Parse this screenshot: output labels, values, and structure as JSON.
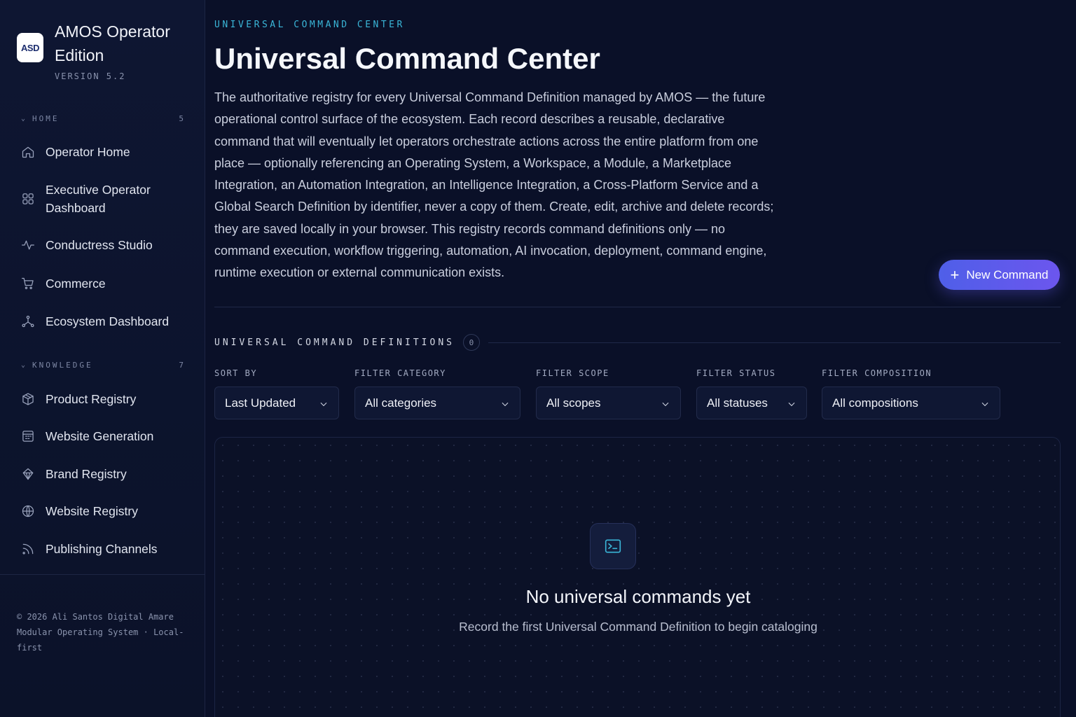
{
  "sidebar": {
    "logo_text": "ASD",
    "brand_title": "AMOS Operator Edition",
    "version": "VERSION 5.2",
    "sections": [
      {
        "label": "HOME",
        "count": "5",
        "items": [
          {
            "label": "Operator Home",
            "icon": "home-icon"
          },
          {
            "label": "Executive Operator Dashboard",
            "icon": "grid-icon"
          },
          {
            "label": "Conductress Studio",
            "icon": "activity-icon"
          },
          {
            "label": "Commerce",
            "icon": "cart-icon"
          },
          {
            "label": "Ecosystem Dashboard",
            "icon": "network-icon"
          }
        ]
      },
      {
        "label": "KNOWLEDGE",
        "count": "7",
        "items": [
          {
            "label": "Product Registry",
            "icon": "package-icon"
          },
          {
            "label": "Website Generation",
            "icon": "layout-icon"
          },
          {
            "label": "Brand Registry",
            "icon": "gem-icon"
          },
          {
            "label": "Website Registry",
            "icon": "globe-icon"
          },
          {
            "label": "Publishing Channels",
            "icon": "rss-icon"
          }
        ]
      }
    ],
    "footer": "© 2026 Ali Santos Digital Amare Modular Operating System · Local-first"
  },
  "header": {
    "eyebrow": "UNIVERSAL COMMAND CENTER",
    "title": "Universal Command Center",
    "description": "The authoritative registry for every Universal Command Definition managed by AMOS — the future operational control surface of the ecosystem. Each record describes a reusable, declarative command that will eventually let operators orchestrate actions across the entire platform from one place — optionally referencing an Operating System, a Workspace, a Module, a Marketplace Integration, an Automation Integration, an Intelligence Integration, a Cross-Platform Service and a Global Search Definition by identifier, never a copy of them. Create, edit, archive and delete records; they are saved locally in your browser. This registry records command definitions only — no command execution, workflow triggering, automation, AI invocation, deployment, command engine, runtime execution or external communication exists.",
    "new_button": "New Command"
  },
  "definitions": {
    "title": "UNIVERSAL COMMAND DEFINITIONS",
    "count": "0"
  },
  "filters": {
    "sort": {
      "label": "SORT BY",
      "value": "Last Updated"
    },
    "category": {
      "label": "FILTER CATEGORY",
      "value": "All categories"
    },
    "scope": {
      "label": "FILTER SCOPE",
      "value": "All scopes"
    },
    "status": {
      "label": "FILTER STATUS",
      "value": "All statuses"
    },
    "composition": {
      "label": "FILTER COMPOSITION",
      "value": "All compositions"
    }
  },
  "empty_state": {
    "icon": "terminal-icon",
    "title": "No universal commands yet",
    "subtitle": "Record the first Universal Command Definition to begin cataloging"
  },
  "colors": {
    "background": "#0a1028",
    "accent_cyan": "#3ab6d8",
    "button_gradient_start": "#4f5fe8",
    "button_gradient_end": "#6c56ee"
  }
}
